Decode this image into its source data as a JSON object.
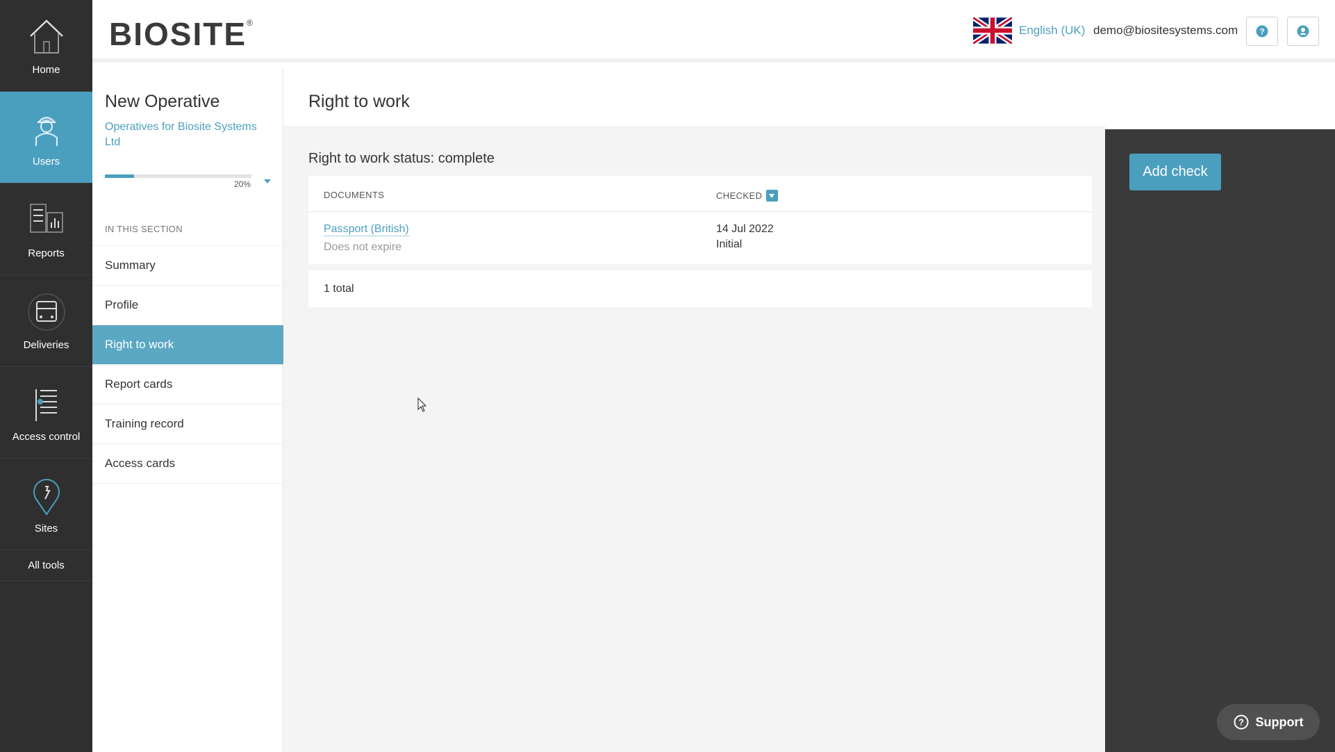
{
  "nav": {
    "items": [
      {
        "label": "Home",
        "icon": "home-icon"
      },
      {
        "label": "Users",
        "icon": "users-icon",
        "active": true
      },
      {
        "label": "Reports",
        "icon": "reports-icon"
      },
      {
        "label": "Deliveries",
        "icon": "deliveries-icon"
      },
      {
        "label": "Access control",
        "icon": "access-control-icon"
      },
      {
        "label": "Sites",
        "icon": "sites-icon"
      }
    ],
    "all_tools": "All tools"
  },
  "header": {
    "logo": "BIOSITE",
    "logo_mark": "®",
    "language": "English (UK)",
    "user_email": "demo@biositesystems.com",
    "help_icon": "help-icon",
    "account_icon": "account-icon"
  },
  "section": {
    "title": "New Operative",
    "subtitle": "Operatives for Biosite Systems Ltd",
    "progress_percent": 20,
    "progress_label": "20%",
    "heading": "IN THIS SECTION",
    "items": [
      "Summary",
      "Profile",
      "Right to work",
      "Report cards",
      "Training record",
      "Access cards"
    ],
    "active_index": 2
  },
  "main": {
    "title": "Right to work",
    "status": "Right to work status: complete",
    "table": {
      "col_documents": "DOCUMENTS",
      "col_checked": "CHECKED",
      "rows": [
        {
          "name": "Passport (British)",
          "expiry": "Does not expire",
          "date": "14 Jul 2022",
          "type": "Initial"
        }
      ]
    },
    "total": "1 total"
  },
  "actions": {
    "add_check": "Add check",
    "support": "Support"
  },
  "colors": {
    "accent": "#4b9fbe",
    "sidebar_bg": "#2f2f2f",
    "panel_bg": "#3a3a3a"
  }
}
